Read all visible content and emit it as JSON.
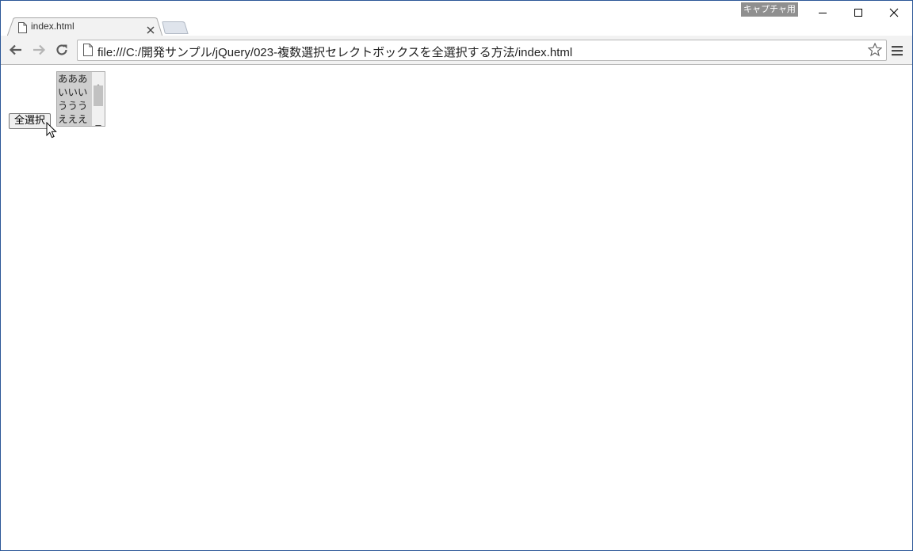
{
  "window": {
    "capture_badge": "キャプチャ用"
  },
  "tab": {
    "title": "index.html"
  },
  "toolbar": {
    "url": "file:///C:/開発サンプル/jQuery/023-複数選択セレクトボックスを全選択する方法/index.html"
  },
  "page": {
    "select_all_label": "全選択",
    "listbox_options": [
      "あああ",
      "いいい",
      "ううう",
      "えええ"
    ]
  },
  "icons": {
    "tab": "page-icon",
    "omnibox": "page-icon",
    "bookmark": "star-icon",
    "menu": "hamburger-icon"
  },
  "colors": {
    "window_border": "#2b5797",
    "selected_option": "#cecece",
    "capture_badge": "#8f8f8f"
  }
}
